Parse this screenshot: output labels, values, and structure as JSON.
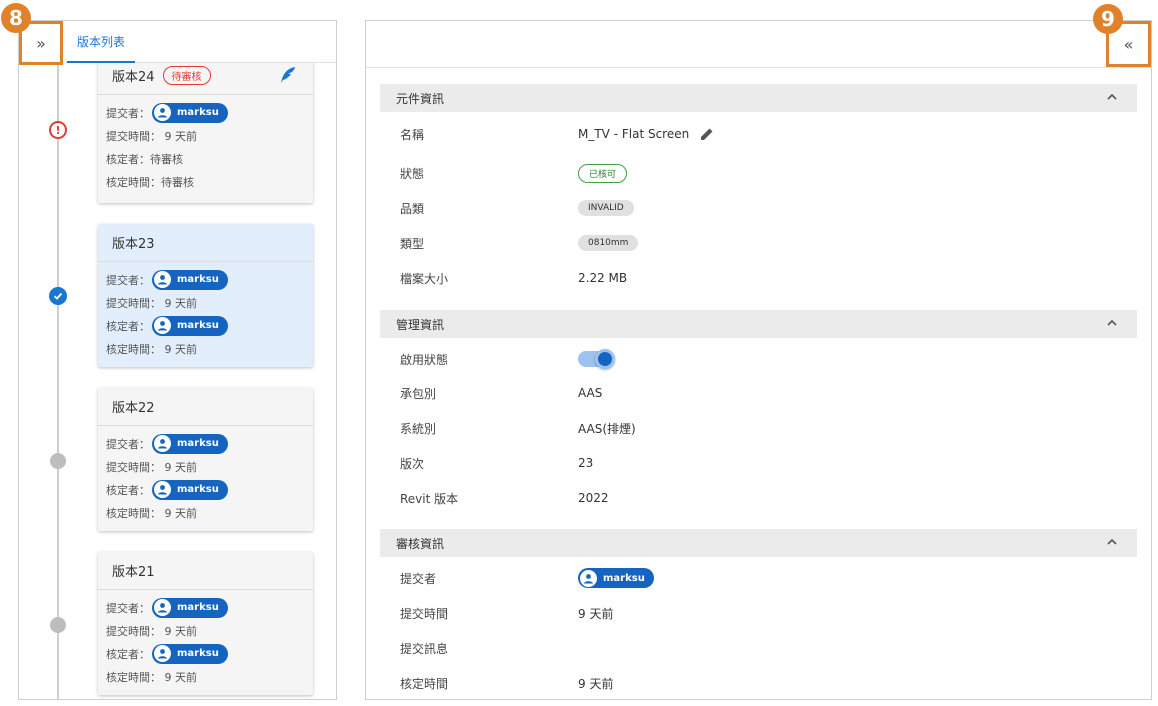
{
  "badges": {
    "left": "8",
    "right": "9"
  },
  "left": {
    "expand_glyph": "»",
    "tab_label": "版本列表",
    "cards": [
      {
        "title": "版本24",
        "pending_chip": "待審核",
        "rows": {
          "submitter_label": "提交者：",
          "submitter": "marksu",
          "submit_time_label": "提交時間：",
          "submit_time": "9 天前",
          "approver_label": "核定者：",
          "approver_text": "待審核",
          "approve_time_label": "核定時間：",
          "approve_time": "待審核"
        }
      },
      {
        "title": "版本23",
        "rows": {
          "submitter_label": "提交者：",
          "submitter": "marksu",
          "submit_time_label": "提交時間：",
          "submit_time": "9 天前",
          "approver_label": "核定者：",
          "approver": "marksu",
          "approve_time_label": "核定時間：",
          "approve_time": "9 天前"
        }
      },
      {
        "title": "版本22",
        "rows": {
          "submitter_label": "提交者：",
          "submitter": "marksu",
          "submit_time_label": "提交時間：",
          "submit_time": "9 天前",
          "approver_label": "核定者：",
          "approver": "marksu",
          "approve_time_label": "核定時間：",
          "approve_time": "9 天前"
        }
      },
      {
        "title": "版本21",
        "rows": {
          "submitter_label": "提交者：",
          "submitter": "marksu",
          "submit_time_label": "提交時間：",
          "submit_time": "9 天前",
          "approver_label": "核定者：",
          "approver": "marksu",
          "approve_time_label": "核定時間：",
          "approve_time": "9 天前"
        }
      }
    ]
  },
  "right": {
    "collapse_glyph": "«",
    "sections": {
      "component": {
        "title": "元件資訊"
      },
      "management": {
        "title": "管理資訊"
      },
      "review": {
        "title": "審核資訊"
      }
    },
    "props": {
      "name_label": "名稱",
      "name_value": "M_TV - Flat Screen",
      "status_label": "狀態",
      "status_value": "已核可",
      "category_label": "品類",
      "category_value": "INVALID",
      "type_label": "類型",
      "type_value": "0810mm",
      "filesize_label": "檔案大小",
      "filesize_value": "2.22 MB",
      "enabled_label": "啟用狀態",
      "contractor_label": "承包別",
      "contractor_value": "AAS",
      "system_label": "系統別",
      "system_value": "AAS(排煙)",
      "version_label": "版次",
      "version_value": "23",
      "revit_label": "Revit 版本",
      "revit_value": "2022",
      "submitter_label": "提交者",
      "submitter_value": "marksu",
      "submit_time_label": "提交時間",
      "submit_time_value": "9 天前",
      "submit_msg_label": "提交訊息",
      "approve_time_label": "核定時間",
      "approve_time_value": "9 天前"
    },
    "colors": {
      "accent": "#1565c0",
      "highlight": "#e0812c",
      "approved": "#43a047",
      "warning": "#e53935"
    }
  }
}
